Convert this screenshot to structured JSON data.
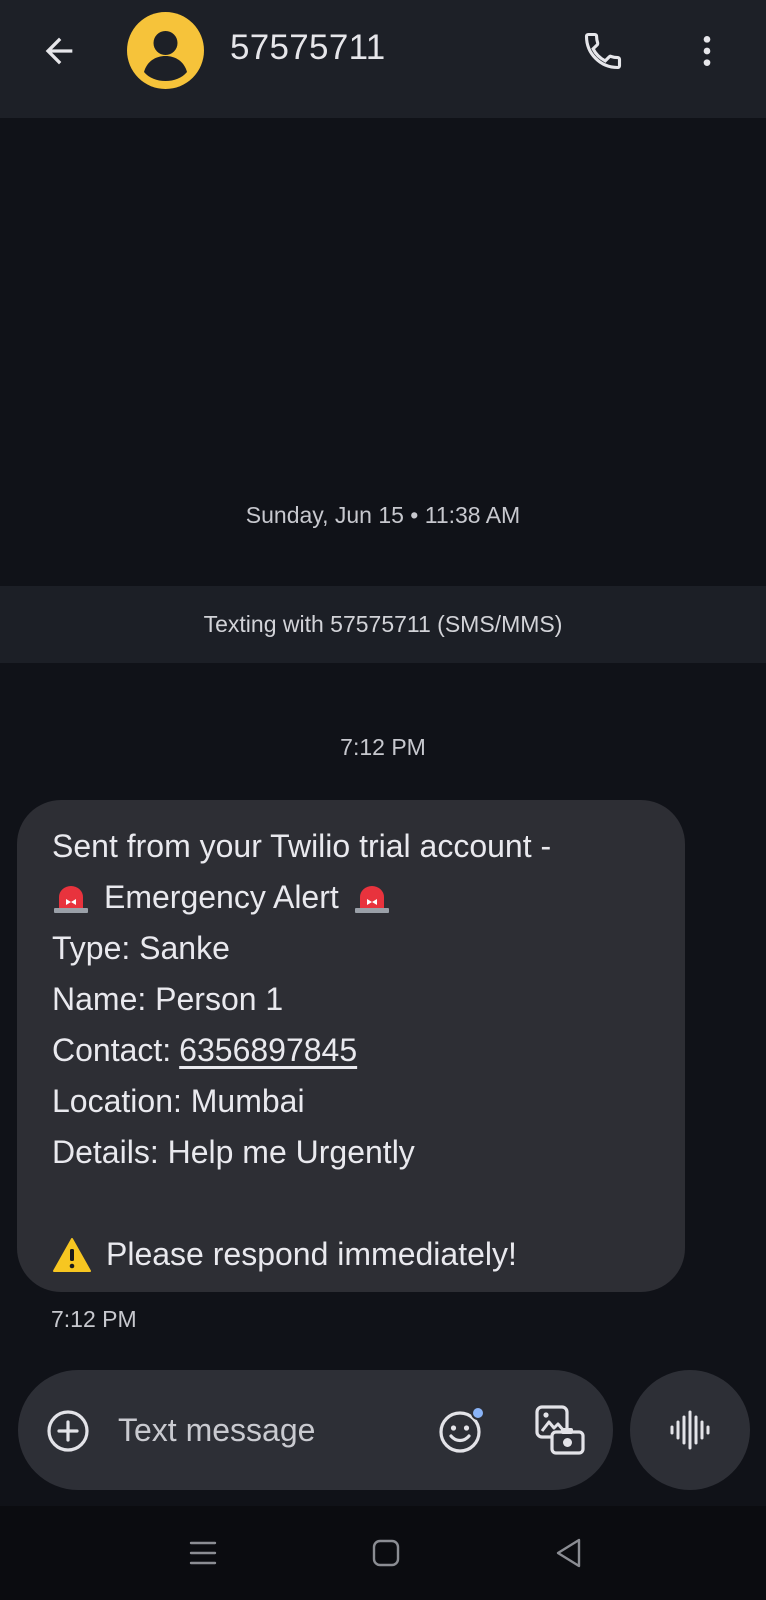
{
  "header": {
    "contact_name": "57575711",
    "avatar_color": "#f6c33a",
    "icons": [
      "back-arrow-icon",
      "person-icon",
      "phone-icon",
      "more-vert-icon"
    ]
  },
  "conversation": {
    "date_separator": "Sunday, Jun 15 • 11:38 AM",
    "texting_banner": "Texting with 57575711 (SMS/MMS)",
    "time_separator": "7:12 PM",
    "message": {
      "line1": "Sent from your Twilio trial account -",
      "line2": "Emergency Alert",
      "line3": "Type: Sanke",
      "line4": "Name: Person 1",
      "contact_label": "Contact:",
      "contact_number": "6356897845",
      "line6": "Location: Mumbai",
      "line7": "Details: Help me Urgently",
      "line9": "Please respond immediately!",
      "icons": [
        "siren-icon",
        "warning-icon"
      ]
    },
    "message_time": "7:12 PM"
  },
  "composer": {
    "placeholder": "Text message",
    "icons": [
      "add-circle-icon",
      "emoji-icon",
      "gallery-icon",
      "voice-waveform-icon"
    ]
  },
  "navbar": {
    "icons": [
      "recents-icon",
      "home-icon",
      "back-triangle-icon"
    ]
  }
}
